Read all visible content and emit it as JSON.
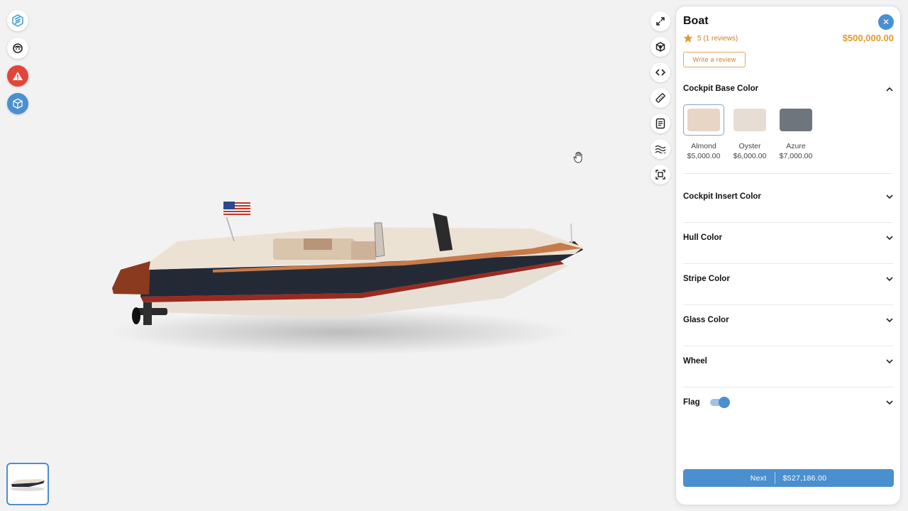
{
  "viewer": {
    "left_icons": [
      "brand-logo-icon",
      "face-icon",
      "warning-icon",
      "cube-icon"
    ],
    "toolbar_icons": [
      "expand-icon",
      "ar-cube-icon",
      "code-icon",
      "ruler-icon",
      "document-icon",
      "waves-icon",
      "fit-frame-icon"
    ],
    "cursor_icon": "hand-cursor-icon"
  },
  "product": {
    "title": "Boat",
    "rating": "5",
    "reviews": "(1 reviews)",
    "price": "$500,000.00",
    "write_review": "Write a review"
  },
  "sections": {
    "cockpit_base": {
      "label": "Cockpit Base Color",
      "options": [
        {
          "name": "Almond",
          "price": "$5,000.00",
          "color": "#e7d6c6"
        },
        {
          "name": "Oyster",
          "price": "$6,000.00",
          "color": "#e6ddd4"
        },
        {
          "name": "Azure",
          "price": "$7,000.00",
          "color": "#6f757c"
        }
      ]
    },
    "cockpit_insert": {
      "label": "Cockpit Insert Color"
    },
    "hull": {
      "label": "Hull Color"
    },
    "stripe": {
      "label": "Stripe Color"
    },
    "glass": {
      "label": "Glass Color"
    },
    "wheel": {
      "label": "Wheel"
    },
    "flag": {
      "label": "Flag",
      "enabled": true
    }
  },
  "footer": {
    "next_label": "Next",
    "total": "$527,186.00"
  },
  "colors": {
    "accent": "#4a8fd0",
    "price": "#e49a2b",
    "warning": "#e2463b"
  }
}
